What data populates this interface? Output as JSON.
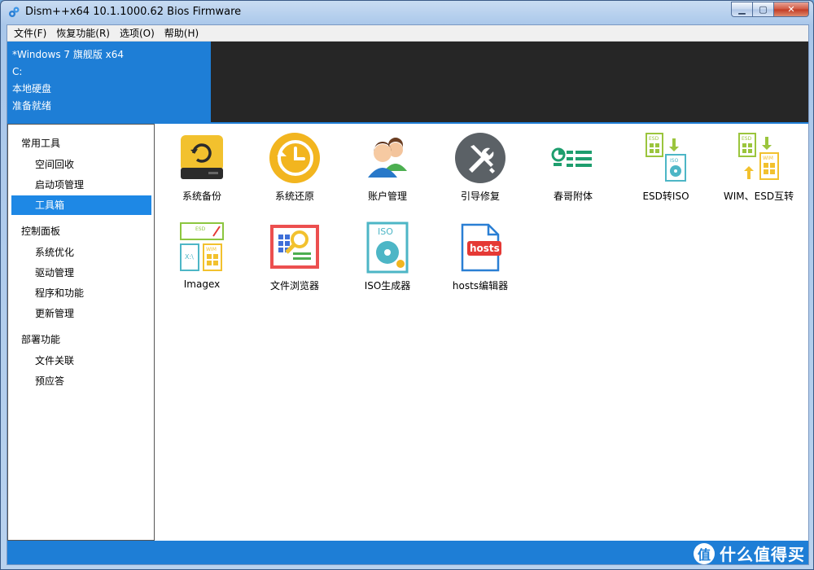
{
  "window": {
    "title": "Dism++x64 10.1.1000.62 Bios Firmware"
  },
  "menu": [
    {
      "label": "文件(F)"
    },
    {
      "label": "恢复功能(R)"
    },
    {
      "label": "选项(O)"
    },
    {
      "label": "帮助(H)"
    }
  ],
  "info": {
    "os": "*Windows 7 旗舰版 x64",
    "drive": "C:",
    "disk_type": "本地硬盘",
    "status": "准备就绪"
  },
  "sidebar": {
    "groups": [
      {
        "label": "常用工具",
        "items": [
          {
            "label": "空间回收"
          },
          {
            "label": "启动项管理"
          },
          {
            "label": "工具箱"
          }
        ]
      },
      {
        "label": "控制面板",
        "items": [
          {
            "label": "系统优化"
          },
          {
            "label": "驱动管理"
          },
          {
            "label": "程序和功能"
          },
          {
            "label": "更新管理"
          }
        ]
      },
      {
        "label": "部署功能",
        "items": [
          {
            "label": "文件关联"
          },
          {
            "label": "预应答"
          }
        ]
      }
    ],
    "active_item": "工具箱"
  },
  "tools": [
    {
      "label": "系统备份",
      "icon": "drive-backup-icon"
    },
    {
      "label": "系统还原",
      "icon": "clock-restore-icon"
    },
    {
      "label": "账户管理",
      "icon": "users-icon"
    },
    {
      "label": "引导修复",
      "icon": "wrench-screwdriver-icon"
    },
    {
      "label": "春哥附体",
      "icon": "list-chart-icon"
    },
    {
      "label": "ESD转ISO",
      "icon": "esd-iso-icon"
    },
    {
      "label": "WIM、ESD互转",
      "icon": "wim-esd-icon"
    },
    {
      "label": "Imagex",
      "icon": "imagex-icon"
    },
    {
      "label": "文件浏览器",
      "icon": "file-browser-icon"
    },
    {
      "label": "ISO生成器",
      "icon": "iso-disc-icon"
    },
    {
      "label": "hosts编辑器",
      "icon": "hosts-file-icon"
    }
  ],
  "watermark": {
    "logo": "值",
    "text": "什么值得买"
  },
  "colors": {
    "accent": "#1e7ed6",
    "dark_panel": "#262626",
    "active": "#1e88e5"
  }
}
